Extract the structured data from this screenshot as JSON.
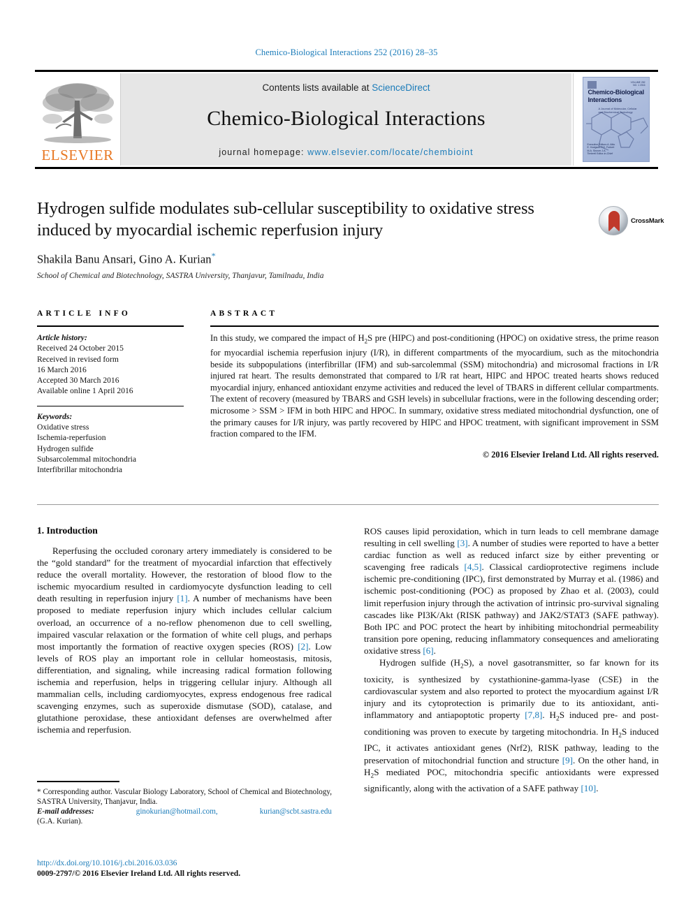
{
  "running_head": "Chemico-Biological Interactions 252 (2016) 28–35",
  "masthead": {
    "publisher_name": "ELSEVIER",
    "contents_prefix": "Contents lists available at ",
    "contents_link": "ScienceDirect",
    "journal_title": "Chemico-Biological Interactions",
    "homepage_label": "journal homepage: ",
    "homepage_url": "www.elsevier.com/locate/chembioint",
    "cover": {
      "title_line1": "Chemico-Biological",
      "title_line2": "Interactions",
      "subtitle": "A Journal of Molecular, Cellular and Biochemical Toxicology",
      "volume_info": "VOLUME 252\nNO. 1 2016",
      "footer_text": "Executive Editors\nA. Aitio\nE. Hodgson\nP.G. Forkert\nM.A. Sirover\nJ.A. Timbrell\nEditor-in-Chief"
    }
  },
  "article": {
    "title": "Hydrogen sulfide modulates sub-cellular susceptibility to oxidative stress induced by myocardial ischemic reperfusion injury",
    "authors": "Shakila Banu Ansari, Gino A. Kurian",
    "corresponding_marker": "*",
    "affiliation": "School of Chemical and Biotechnology, SASTRA University, Thanjavur, Tamilnadu, India",
    "crossmark_label": "CrossMark"
  },
  "article_info": {
    "heading": "ARTICLE INFO",
    "history_label": "Article history:",
    "history": [
      "Received 24 October 2015",
      "Received in revised form",
      "16 March 2016",
      "Accepted 30 March 2016",
      "Available online 1 April 2016"
    ],
    "keywords_label": "Keywords:",
    "keywords": [
      "Oxidative stress",
      "Ischemia-reperfusion",
      "Hydrogen sulfide",
      "Subsarcolemmal mitochondria",
      "Interfibrillar mitochondria"
    ]
  },
  "abstract": {
    "heading": "ABSTRACT",
    "text": "In this study, we compared the impact of H2S pre (HIPC) and post-conditioning (HPOC) on oxidative stress, the prime reason for myocardial ischemia reperfusion injury (I/R), in different compartments of the myocardium, such as the mitochondria beside its subpopulations (interfibrillar (IFM) and sub-sarcolemmal (SSM) mitochondria) and microsomal fractions in I/R injured rat heart. The results demonstrated that compared to I/R rat heart, HIPC and HPOC treated hearts shows reduced myocardial injury, enhanced antioxidant enzyme activities and reduced the level of TBARS in different cellular compartments. The extent of recovery (measured by TBARS and GSH levels) in subcellular fractions, were in the following descending order; microsome > SSM > IFM in both HIPC and HPOC. In summary, oxidative stress mediated mitochondrial dysfunction, one of the primary causes for I/R injury, was partly recovered by HIPC and HPOC treatment, with significant improvement in SSM fraction compared to the IFM.",
    "copyright": "© 2016 Elsevier Ireland Ltd. All rights reserved."
  },
  "introduction": {
    "heading": "1. Introduction",
    "left_para_1": "Reperfusing the occluded coronary artery immediately is considered to be the “gold standard” for the treatment of myocardial infarction that effectively reduce the overall mortality. However, the restoration of blood flow to the ischemic myocardium resulted in cardiomyocyte dysfunction leading to cell death resulting in reperfusion injury [1]. A number of mechanisms have been proposed to mediate reperfusion injury which includes cellular calcium overload, an occurrence of a no-reflow phenomenon due to cell swelling, impaired vascular relaxation or the formation of white cell plugs, and perhaps most importantly the formation of reactive oxygen species (ROS) [2]. Low levels of ROS play an important role in cellular homeostasis, mitosis, differentiation, and signaling, while increasing radical formation following ischemia and reperfusion, helps in triggering cellular injury. Although all mammalian cells, including cardiomyocytes, express endogenous free radical scavenging enzymes, such as superoxide dismutase (SOD), catalase, and glutathione peroxidase, these antioxidant defenses are overwhelmed after ischemia and reperfusion.",
    "right_para_1": "ROS causes lipid peroxidation, which in turn leads to cell membrane damage resulting in cell swelling [3]. A number of studies were reported to have a better cardiac function as well as reduced infarct size by either preventing or scavenging free radicals [4,5]. Classical cardioprotective regimens include ischemic pre-conditioning (IPC), first demonstrated by Murray et al. (1986) and ischemic post-conditioning (POC) as proposed by Zhao et al. (2003), could limit reperfusion injury through the activation of intrinsic pro-survival signaling cascades like PI3K/Akt (RISK pathway) and JAK2/STAT3 (SAFE pathway). Both IPC and POC protect the heart by inhibiting mitochondrial permeability transition pore opening, reducing inflammatory consequences and ameliorating oxidative stress [6].",
    "right_para_2": "Hydrogen sulfide (H2S), a novel gasotransmitter, so far known for its toxicity, is synthesized by cystathionine-gamma-lyase (CSE) in the cardiovascular system and also reported to protect the myocardium against I/R injury and its cytoprotection is primarily due to its antioxidant, anti-inflammatory and antiapoptotic property [7,8]. H2S induced pre- and post-conditioning was proven to execute by targeting mitochondria. In H2S induced IPC, it activates antioxidant genes (Nrf2), RISK pathway, leading to the preservation of mitochondrial function and structure [9]. On the other hand, in H2S mediated POC, mitochondria specific antioxidants were expressed significantly, along with the activation of a SAFE pathway [10]."
  },
  "footnote": {
    "corresponding": "* Corresponding author. Vascular Biology Laboratory, School of Chemical and Biotechnology, SASTRA University, Thanjavur, India.",
    "email_label": "E-mail addresses:",
    "email_1": "ginokurian@hotmail.com,",
    "email_2": "kurian@scbt.sastra.edu",
    "email_attrib": "(G.A. Kurian)."
  },
  "bottom": {
    "doi": "http://dx.doi.org/10.1016/j.cbi.2016.03.036",
    "issn": "0009-2797/© 2016 Elsevier Ireland Ltd. All rights reserved."
  },
  "colors": {
    "link": "#1a7bb9",
    "elsevier_orange": "#E87722",
    "band_grey": "#e6e6e6"
  }
}
